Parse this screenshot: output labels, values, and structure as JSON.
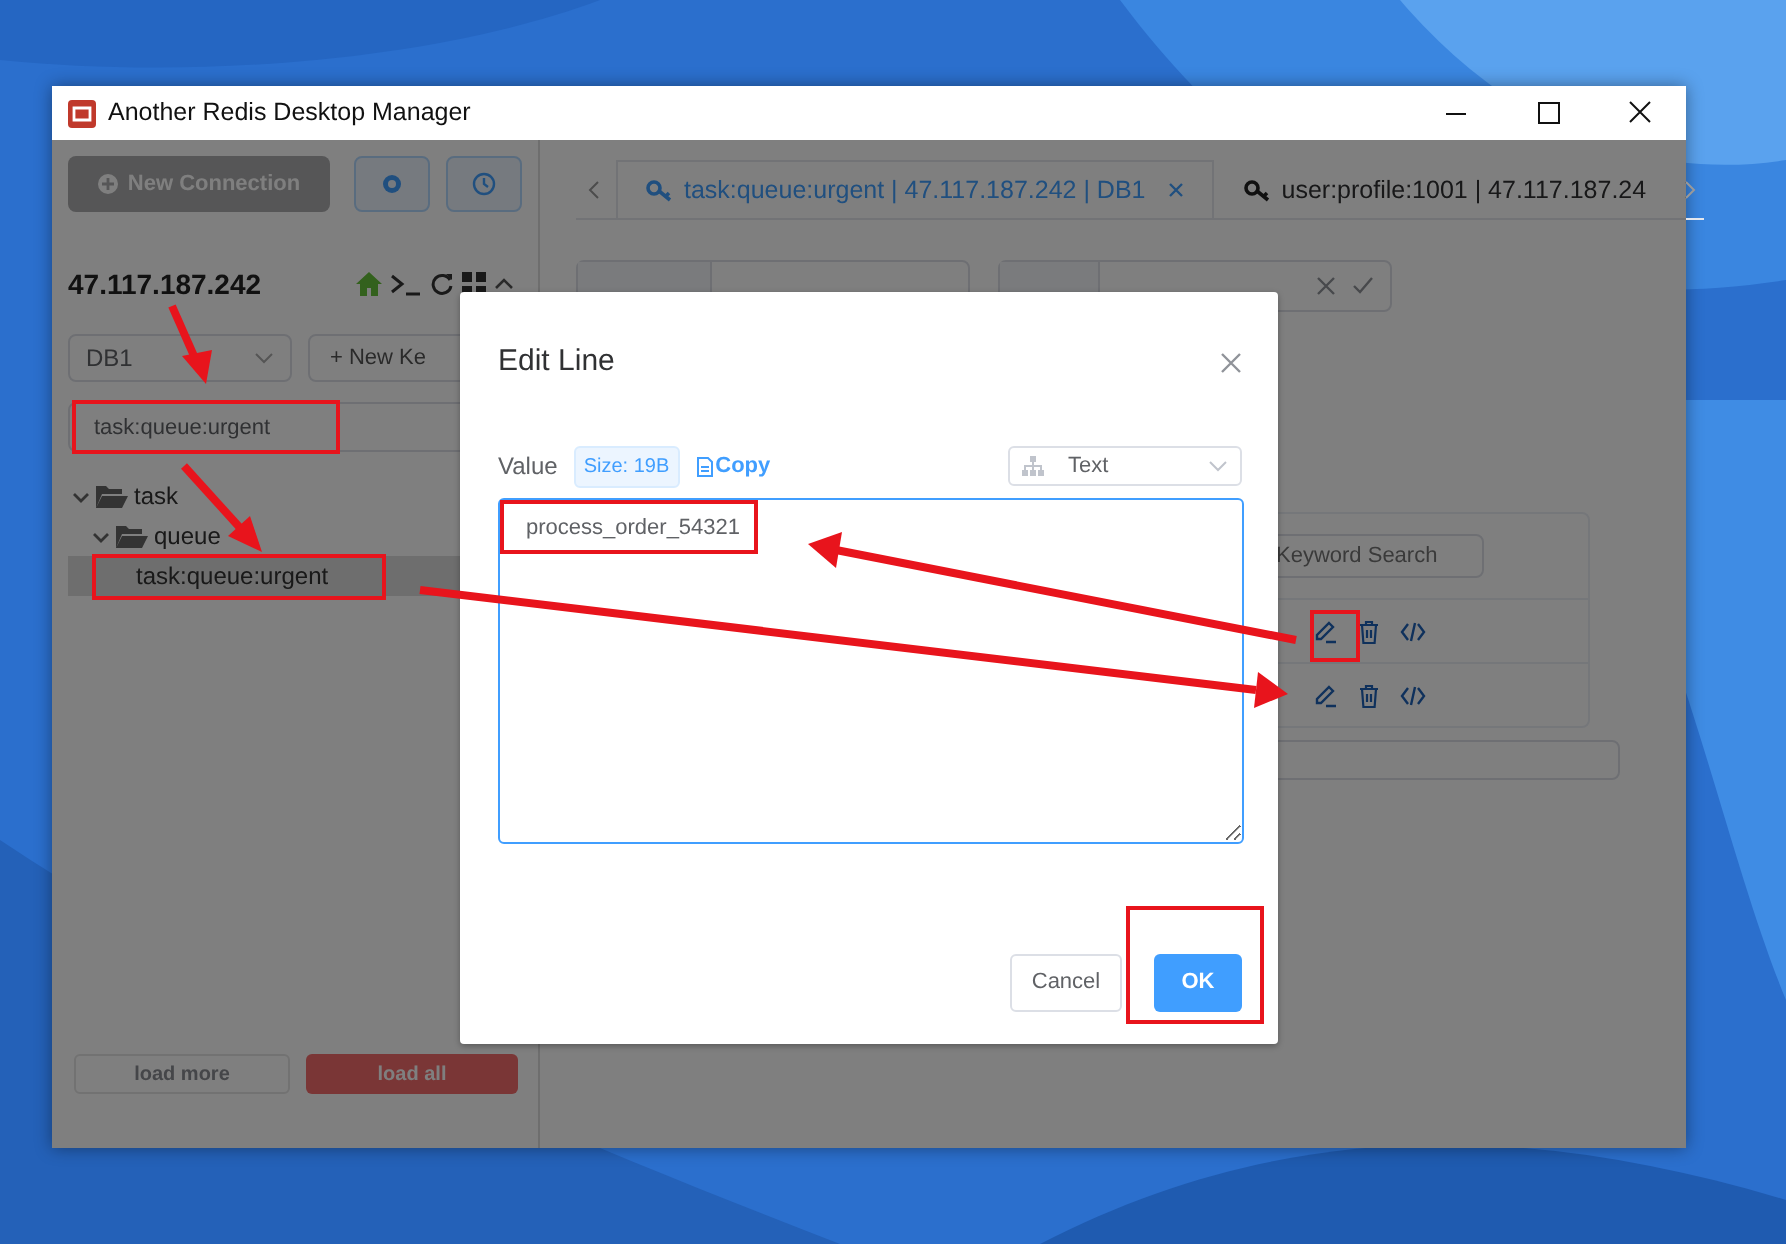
{
  "window": {
    "title": "Another Redis Desktop Manager"
  },
  "sidebar": {
    "new_connection": "New Connection",
    "host": "47.117.187.242",
    "db_select": "DB1",
    "new_key": "+ New Ke",
    "search_value": "task:queue:urgent",
    "tree": [
      {
        "label": "task",
        "expanded": true,
        "children": [
          {
            "label": "queue",
            "expanded": true,
            "children": [
              {
                "label": "task:queue:urgent",
                "selected": true
              }
            ]
          }
        ]
      }
    ],
    "load_more": "load more",
    "load_all": "load all"
  },
  "tabs": [
    {
      "label": "task:queue:urgent | 47.117.187.242 | DB1",
      "selected": true
    },
    {
      "label": "user:profile:1001 | 47.117.187.24",
      "selected": false
    }
  ],
  "value_table": {
    "search_placeholder": "Keyword Search",
    "rows": [
      {
        "kind": "actions"
      },
      {
        "kind": "actions"
      }
    ]
  },
  "dialog": {
    "title": "Edit Line",
    "value_label": "Value",
    "size_badge": "Size: 19B",
    "copy": "Copy",
    "format": "Text",
    "value": "process_order_54321",
    "cancel": "Cancel",
    "ok": "OK"
  }
}
